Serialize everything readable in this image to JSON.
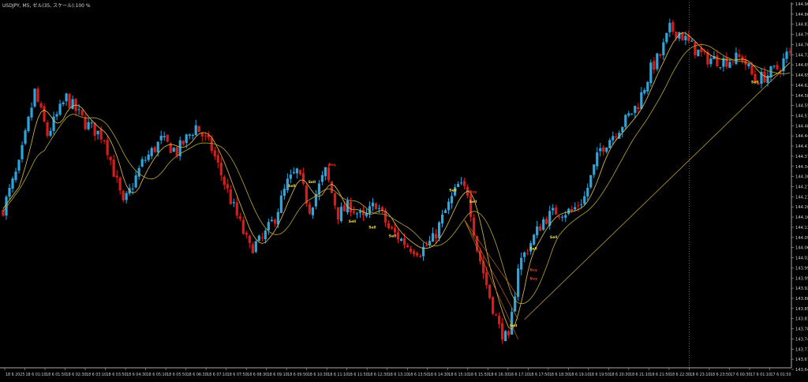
{
  "header": {
    "info": "USDJPY, M5, ゼル(35, スケール):100 %"
  },
  "colors": {
    "background": "#000000",
    "axis": "#aaaaaa",
    "label": "#cfcfcf",
    "bull": "#2aa6e0",
    "bear": "#e11818",
    "ma_fast": "#e8c24a",
    "ma_slow": "#b8a634",
    "trend": "#b79a3a",
    "fan": "#d87a18",
    "signal_sell": "#f2e24a",
    "signal_buy": "#e03a2a",
    "vline": "#888888"
  },
  "chart_data": {
    "type": "candlestick",
    "symbol": "USDJPY",
    "timeframe": "M5",
    "grid": false,
    "y_ticks": [
      "144.900",
      "144.865",
      "144.830",
      "144.795",
      "144.760",
      "144.725",
      "144.690",
      "144.655",
      "144.620",
      "144.585",
      "144.550",
      "144.515",
      "144.480",
      "144.445",
      "144.410",
      "144.375",
      "144.340",
      "144.305",
      "144.270",
      "144.235",
      "144.200",
      "144.165",
      "144.130",
      "144.095",
      "144.060",
      "144.025",
      "143.990",
      "143.955",
      "143.920",
      "143.885",
      "143.850",
      "143.815",
      "143.780",
      "143.745",
      "143.710",
      "143.675",
      "143.640"
    ],
    "x_ticks": [
      "18 6 2025",
      "18 6 01:10",
      "18 6 01:50",
      "18 6 02:30",
      "18 6 03:10",
      "18 6 03:50",
      "18 6 04:30",
      "18 6 05:10",
      "18 6 05:50",
      "18 6 06:30",
      "18 6 07:10",
      "18 6 07:50",
      "18 6 08:30",
      "18 6 09:10",
      "18 6 09:50",
      "18 6 10:30",
      "18 6 11:10",
      "18 6 11:50",
      "18 6 12:30",
      "18 6 13:10",
      "18 6 13:50",
      "18 6 14:30",
      "18 6 15:10",
      "18 6 15:50",
      "18 6 16:30",
      "18 6 17:10",
      "18 6 17:50",
      "18 6 18:30",
      "18 6 19:10",
      "18 6 19:50",
      "18 6 20:30",
      "18 6 21:10",
      "18 6 21:50",
      "18 6 22:30",
      "18 6 23:10",
      "18 6 23:50",
      "17 6 00:30",
      "17 6 01:10",
      "17 6 01:50"
    ],
    "close_path": [
      {
        "i": 0,
        "v": 144.19
      },
      {
        "i": 5,
        "v": 144.34
      },
      {
        "i": 10,
        "v": 144.6
      },
      {
        "i": 14,
        "v": 144.45
      },
      {
        "i": 20,
        "v": 144.58
      },
      {
        "i": 26,
        "v": 144.49
      },
      {
        "i": 32,
        "v": 144.44
      },
      {
        "i": 38,
        "v": 144.2
      },
      {
        "i": 44,
        "v": 144.35
      },
      {
        "i": 50,
        "v": 144.43
      },
      {
        "i": 55,
        "v": 144.39
      },
      {
        "i": 61,
        "v": 144.48
      },
      {
        "i": 66,
        "v": 144.4
      },
      {
        "i": 72,
        "v": 144.22
      },
      {
        "i": 78,
        "v": 144.05
      },
      {
        "i": 82,
        "v": 144.08
      },
      {
        "i": 86,
        "v": 144.16
      },
      {
        "i": 90,
        "v": 144.28
      },
      {
        "i": 93,
        "v": 144.32
      },
      {
        "i": 97,
        "v": 144.19
      },
      {
        "i": 102,
        "v": 144.32
      },
      {
        "i": 106,
        "v": 144.17
      },
      {
        "i": 110,
        "v": 144.2
      },
      {
        "i": 114,
        "v": 144.15
      },
      {
        "i": 118,
        "v": 144.21
      },
      {
        "i": 122,
        "v": 144.12
      },
      {
        "i": 128,
        "v": 144.06
      },
      {
        "i": 132,
        "v": 144.04
      },
      {
        "i": 136,
        "v": 144.08
      },
      {
        "i": 140,
        "v": 144.18
      },
      {
        "i": 144,
        "v": 144.27
      },
      {
        "i": 147,
        "v": 144.25
      },
      {
        "i": 150,
        "v": 144.05
      },
      {
        "i": 154,
        "v": 143.88
      },
      {
        "i": 157,
        "v": 143.77
      },
      {
        "i": 160,
        "v": 143.72
      },
      {
        "i": 163,
        "v": 143.99
      },
      {
        "i": 167,
        "v": 144.07
      },
      {
        "i": 171,
        "v": 144.15
      },
      {
        "i": 175,
        "v": 144.18
      },
      {
        "i": 180,
        "v": 144.18
      },
      {
        "i": 184,
        "v": 144.23
      },
      {
        "i": 189,
        "v": 144.4
      },
      {
        "i": 193,
        "v": 144.45
      },
      {
        "i": 197,
        "v": 144.5
      },
      {
        "i": 201,
        "v": 144.56
      },
      {
        "i": 205,
        "v": 144.68
      },
      {
        "i": 208,
        "v": 144.73
      },
      {
        "i": 211,
        "v": 144.82
      },
      {
        "i": 214,
        "v": 144.81
      },
      {
        "i": 217,
        "v": 144.77
      },
      {
        "i": 222,
        "v": 144.72
      },
      {
        "i": 228,
        "v": 144.71
      },
      {
        "i": 234,
        "v": 144.72
      },
      {
        "i": 238,
        "v": 144.64
      },
      {
        "i": 242,
        "v": 144.66
      },
      {
        "i": 246,
        "v": 144.69
      },
      {
        "i": 248,
        "v": 144.73
      }
    ],
    "ylim": [
      143.63,
      144.915
    ],
    "vertical_line_at_tick": "18 6 23:10",
    "annotations": [
      {
        "label": "Sell",
        "x_tick": "18 6 09:50",
        "y": 144.265,
        "type": "sell"
      },
      {
        "label": "Sell",
        "x_tick": "18 6 10:30",
        "y": 144.28,
        "type": "sell"
      },
      {
        "label": "Buy",
        "x_tick": "18 6 11:10",
        "y": 144.34,
        "type": "buy"
      },
      {
        "label": "Sell",
        "x_tick": "18 6 11:50",
        "y": 144.14,
        "type": "sell"
      },
      {
        "label": "Sell",
        "x_tick": "18 6 12:30",
        "y": 144.12,
        "type": "sell"
      },
      {
        "label": "Sell",
        "x_tick": "18 6 13:10",
        "y": 144.09,
        "type": "sell"
      },
      {
        "label": "Sell",
        "x_tick": "18 6 15:10",
        "y": 144.25,
        "type": "sell"
      },
      {
        "label": "Buy",
        "x_tick": "18 6 15:50",
        "y": 144.245,
        "type": "buy"
      },
      {
        "label": "Sell",
        "x_tick": "18 6 15:50",
        "y": 144.21,
        "type": "sell"
      },
      {
        "label": "Sell",
        "x_tick": "18 6 17:10",
        "y": 143.775,
        "type": "sell"
      },
      {
        "label": "Sell",
        "x_tick": "18 6 17:50",
        "y": 144.045,
        "type": "sell"
      },
      {
        "label": "Buy",
        "x_tick": "18 6 17:50",
        "y": 143.94,
        "type": "buy"
      },
      {
        "label": "Buy",
        "x_tick": "18 6 17:50",
        "y": 143.97,
        "type": "buy"
      },
      {
        "label": "Sell",
        "x_tick": "18 6 18:30",
        "y": 144.085,
        "type": "sell"
      },
      {
        "label": "Sell",
        "x_tick": "17 6 01:10",
        "y": 144.63,
        "type": "sell"
      }
    ]
  }
}
